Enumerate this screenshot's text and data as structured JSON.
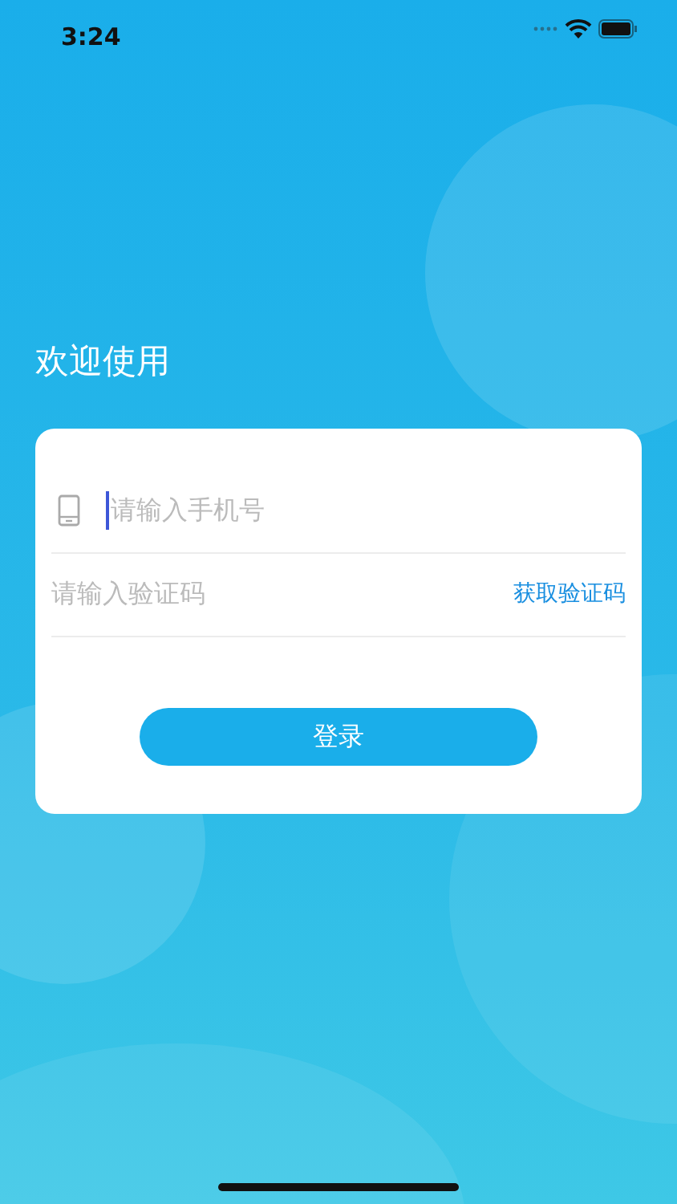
{
  "status_bar": {
    "time": "3:24"
  },
  "title": "欢迎使用",
  "fields": [
    {
      "kind": "phone",
      "placeholder": "请输入手机号",
      "focused": true
    },
    {
      "kind": "code",
      "placeholder": "请输入验证码",
      "action": "获取验证码",
      "focused": false
    }
  ],
  "login_button": "登录"
}
